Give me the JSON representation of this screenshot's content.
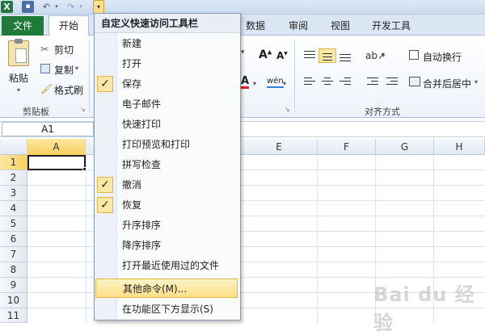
{
  "qat": {
    "app_icon": "X",
    "save_icon": "disk-icon",
    "undo_icon": "↶",
    "redo_icon": "↷",
    "dropdown_glyph": "▾",
    "customize_glyph": "▾"
  },
  "tabs": {
    "file": "文件",
    "home": "开始",
    "data": "数据",
    "review": "审阅",
    "view": "视图",
    "developer": "开发工具"
  },
  "ribbon": {
    "paste_label": "粘贴",
    "cut_label": "剪切",
    "copy_label": "复制",
    "format_painter_label": "格式刷",
    "clipboard_group": "剪贴板",
    "wrap_text_label": "自动换行",
    "merge_center_label": "合并后居中",
    "alignment_group": "对齐方式",
    "font_a": "A",
    "phonetic": "wén"
  },
  "formula_bar": {
    "name_box": "A1"
  },
  "sheet": {
    "columns": [
      "A",
      "E",
      "F",
      "G",
      "H"
    ],
    "rows": [
      "1",
      "2",
      "3",
      "4",
      "5",
      "6",
      "7",
      "8",
      "9",
      "10",
      "11"
    ]
  },
  "menu": {
    "title": "自定义快速访问工具栏",
    "items": [
      {
        "label": "新建",
        "checked": false
      },
      {
        "label": "打开",
        "checked": false
      },
      {
        "label": "保存",
        "checked": true
      },
      {
        "label": "电子邮件",
        "checked": false
      },
      {
        "label": "快速打印",
        "checked": false
      },
      {
        "label": "打印预览和打印",
        "checked": false
      },
      {
        "label": "拼写检查",
        "checked": false
      },
      {
        "label": "撤消",
        "checked": true
      },
      {
        "label": "恢复",
        "checked": true
      },
      {
        "label": "升序排序",
        "checked": false
      },
      {
        "label": "降序排序",
        "checked": false
      },
      {
        "label": "打开最近使用过的文件",
        "checked": false
      }
    ],
    "more_commands": "其他命令(M)...",
    "show_below": "在功能区下方显示(S)",
    "check_glyph": "✓"
  },
  "watermark": "Bai du 经验"
}
